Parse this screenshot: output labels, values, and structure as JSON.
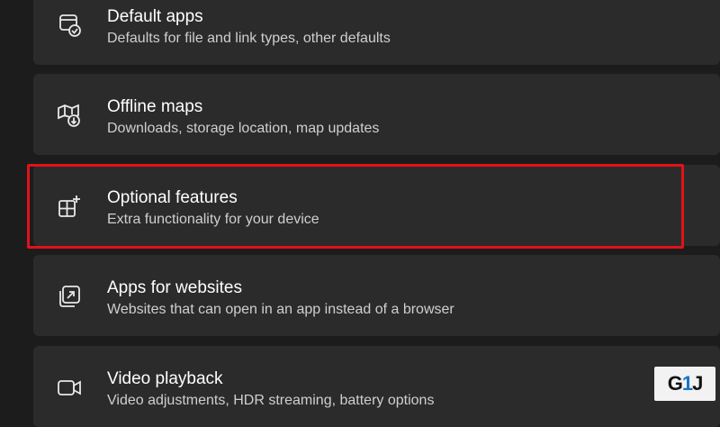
{
  "settings_list": [
    {
      "icon": "default-apps-icon",
      "title": "Default apps",
      "description": "Defaults for file and link types, other defaults"
    },
    {
      "icon": "offline-maps-icon",
      "title": "Offline maps",
      "description": "Downloads, storage location, map updates"
    },
    {
      "icon": "optional-features-icon",
      "title": "Optional features",
      "description": "Extra functionality for your device"
    },
    {
      "icon": "apps-for-websites-icon",
      "title": "Apps for websites",
      "description": "Websites that can open in an app instead of a browser"
    },
    {
      "icon": "video-playback-icon",
      "title": "Video playback",
      "description": "Video adjustments, HDR streaming, battery options"
    }
  ],
  "highlight": {
    "target": "Optional features",
    "color": "#e0121b"
  },
  "watermark": {
    "text_g": "G",
    "text_1": "1",
    "text_j": "J"
  },
  "colors": {
    "background": "#1c1c1c",
    "card": "#2b2b2b",
    "title": "#ffffff",
    "description": "#cfcfcf"
  }
}
